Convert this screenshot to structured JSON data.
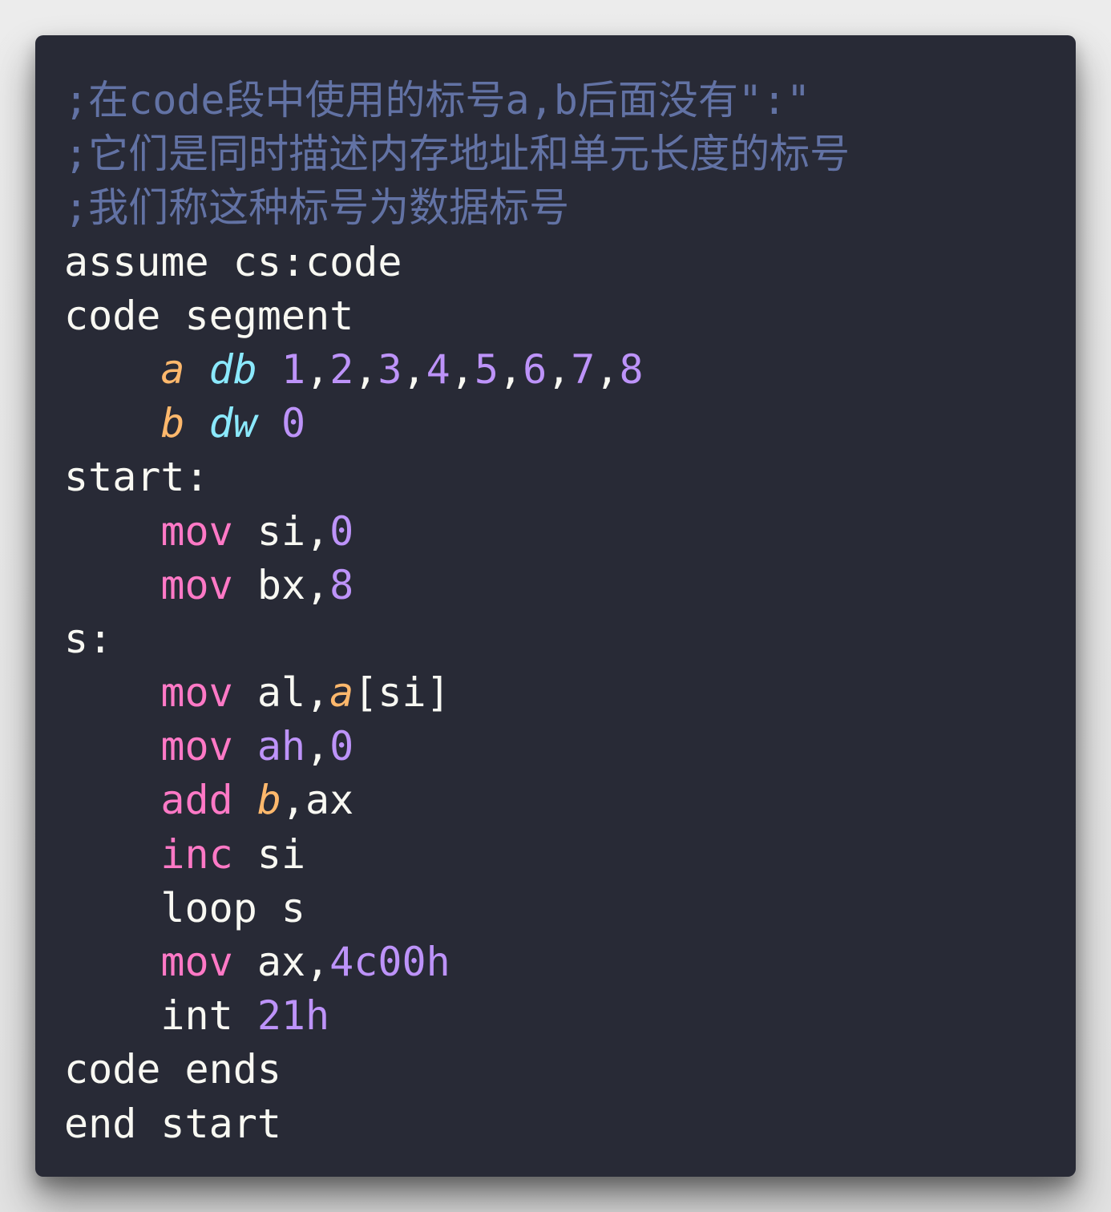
{
  "code_lines": [
    [
      {
        "t": ";在code段中使用的标号a,b后面没有\":\"",
        "c": "comment"
      }
    ],
    [
      {
        "t": ";它们是同时描述内存地址和单元长度的标号",
        "c": "comment"
      }
    ],
    [
      {
        "t": ";我们称这种标号为数据标号",
        "c": "comment"
      }
    ],
    [
      {
        "t": "assume cs:code",
        "c": "plain"
      }
    ],
    [
      {
        "t": "code segment",
        "c": "plain"
      }
    ],
    [
      {
        "t": "    ",
        "c": "plain"
      },
      {
        "t": "a",
        "c": "label"
      },
      {
        "t": " ",
        "c": "plain"
      },
      {
        "t": "db",
        "c": "type"
      },
      {
        "t": " ",
        "c": "plain"
      },
      {
        "t": "1",
        "c": "num"
      },
      {
        "t": ",",
        "c": "plain"
      },
      {
        "t": "2",
        "c": "num"
      },
      {
        "t": ",",
        "c": "plain"
      },
      {
        "t": "3",
        "c": "num"
      },
      {
        "t": ",",
        "c": "plain"
      },
      {
        "t": "4",
        "c": "num"
      },
      {
        "t": ",",
        "c": "plain"
      },
      {
        "t": "5",
        "c": "num"
      },
      {
        "t": ",",
        "c": "plain"
      },
      {
        "t": "6",
        "c": "num"
      },
      {
        "t": ",",
        "c": "plain"
      },
      {
        "t": "7",
        "c": "num"
      },
      {
        "t": ",",
        "c": "plain"
      },
      {
        "t": "8",
        "c": "num"
      }
    ],
    [
      {
        "t": "    ",
        "c": "plain"
      },
      {
        "t": "b",
        "c": "label"
      },
      {
        "t": " ",
        "c": "plain"
      },
      {
        "t": "dw",
        "c": "type"
      },
      {
        "t": " ",
        "c": "plain"
      },
      {
        "t": "0",
        "c": "num"
      }
    ],
    [
      {
        "t": "start:",
        "c": "plain"
      }
    ],
    [
      {
        "t": "    ",
        "c": "plain"
      },
      {
        "t": "mov",
        "c": "kw"
      },
      {
        "t": " si,",
        "c": "plain"
      },
      {
        "t": "0",
        "c": "num"
      }
    ],
    [
      {
        "t": "    ",
        "c": "plain"
      },
      {
        "t": "mov",
        "c": "kw"
      },
      {
        "t": " bx,",
        "c": "plain"
      },
      {
        "t": "8",
        "c": "num"
      }
    ],
    [
      {
        "t": "s:",
        "c": "plain"
      }
    ],
    [
      {
        "t": "    ",
        "c": "plain"
      },
      {
        "t": "mov",
        "c": "kw"
      },
      {
        "t": " al,",
        "c": "plain"
      },
      {
        "t": "a",
        "c": "label"
      },
      {
        "t": "[si]",
        "c": "plain"
      }
    ],
    [
      {
        "t": "    ",
        "c": "plain"
      },
      {
        "t": "mov",
        "c": "kw"
      },
      {
        "t": " ",
        "c": "plain"
      },
      {
        "t": "ah",
        "c": "reg"
      },
      {
        "t": ",",
        "c": "plain"
      },
      {
        "t": "0",
        "c": "num"
      }
    ],
    [
      {
        "t": "    ",
        "c": "plain"
      },
      {
        "t": "add",
        "c": "kw"
      },
      {
        "t": " ",
        "c": "plain"
      },
      {
        "t": "b",
        "c": "label"
      },
      {
        "t": ",ax",
        "c": "plain"
      }
    ],
    [
      {
        "t": "    ",
        "c": "plain"
      },
      {
        "t": "inc",
        "c": "kw"
      },
      {
        "t": " si",
        "c": "plain"
      }
    ],
    [
      {
        "t": "    loop s",
        "c": "plain"
      }
    ],
    [
      {
        "t": "    ",
        "c": "plain"
      },
      {
        "t": "mov",
        "c": "kw"
      },
      {
        "t": " ax,",
        "c": "plain"
      },
      {
        "t": "4c00h",
        "c": "num"
      }
    ],
    [
      {
        "t": "    int ",
        "c": "plain"
      },
      {
        "t": "21h",
        "c": "num"
      }
    ],
    [
      {
        "t": "code ends",
        "c": "plain"
      }
    ],
    [
      {
        "t": "end start",
        "c": "plain"
      }
    ]
  ],
  "colors": {
    "background": "#282a36",
    "comment": "#6272a4",
    "keyword": "#ff79c6",
    "number": "#bd93f9",
    "label": "#ffb86c",
    "type": "#8be9fd",
    "text": "#f8f8f2"
  }
}
